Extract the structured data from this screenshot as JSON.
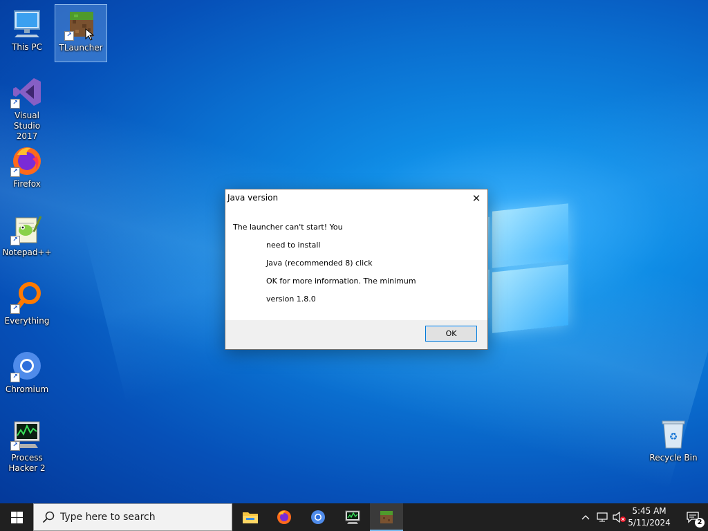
{
  "desktop": {
    "icons": [
      {
        "label": "This PC",
        "icon": "computer-icon"
      },
      {
        "label": "TLauncher",
        "icon": "minecraft-grass-block-icon"
      },
      {
        "label": "Visual Studio\n2017",
        "icon": "visual-studio-icon"
      },
      {
        "label": "Firefox",
        "icon": "firefox-icon"
      },
      {
        "label": "Notepad++",
        "icon": "notepadpp-icon"
      },
      {
        "label": "Everything",
        "icon": "search-magnifier-icon"
      },
      {
        "label": "Chromium",
        "icon": "chromium-icon"
      },
      {
        "label": "Process\nHacker 2",
        "icon": "process-hacker-icon"
      },
      {
        "label": "Recycle Bin",
        "icon": "recycle-bin-icon"
      }
    ],
    "selected_icon": "TLauncher"
  },
  "dialog": {
    "title": "Java version",
    "close_glyph": "✕",
    "message_lines": [
      "The launcher can't start! You",
      "need to install",
      "Java (recommended 8) click",
      "OK for more information. The minimum",
      "version 1.8.0"
    ],
    "ok_label": "OK"
  },
  "taskbar": {
    "search_placeholder": "Type here to search",
    "pinned_apps": [
      "file-explorer-icon",
      "firefox-icon",
      "chromium-icon",
      "process-hacker-icon",
      "tlauncher-icon"
    ],
    "active_app": "tlauncher-icon",
    "time": "5:45 AM",
    "date": "5/11/2024",
    "notification_count": "2"
  },
  "colors": {
    "accent": "#0078d7",
    "taskbar_bg": "#202020",
    "dialog_footer_bg": "#f0f0f0"
  }
}
